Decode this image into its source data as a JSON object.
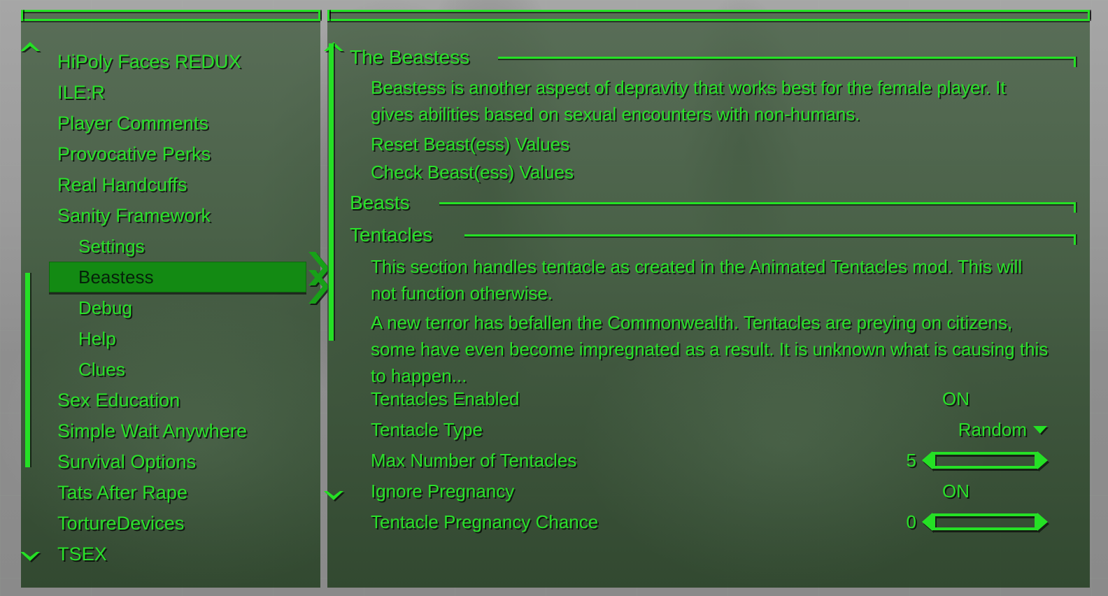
{
  "theme": {
    "accent": "#25e025",
    "text_green": "#2ae02a",
    "selected_bg": "#138a13",
    "selected_text": "#06220a"
  },
  "left_panel": {
    "scroll_up_icon": "chevron-up-icon",
    "scroll_down_icon": "chevron-down-icon",
    "items": [
      {
        "label": "HiPoly Faces REDUX",
        "level": 0,
        "selected": false
      },
      {
        "label": "ILE:R",
        "level": 0,
        "selected": false
      },
      {
        "label": "Player Comments",
        "level": 0,
        "selected": false
      },
      {
        "label": "Provocative Perks",
        "level": 0,
        "selected": false
      },
      {
        "label": "Real Handcuffs",
        "level": 0,
        "selected": false
      },
      {
        "label": "Sanity Framework",
        "level": 0,
        "selected": false
      },
      {
        "label": "Settings",
        "level": 1,
        "selected": false
      },
      {
        "label": "Beastess",
        "level": 1,
        "selected": true
      },
      {
        "label": "Debug",
        "level": 1,
        "selected": false
      },
      {
        "label": "Help",
        "level": 1,
        "selected": false
      },
      {
        "label": "Clues",
        "level": 1,
        "selected": false
      },
      {
        "label": "Sex Education",
        "level": 0,
        "selected": false
      },
      {
        "label": "Simple Wait Anywhere",
        "level": 0,
        "selected": false
      },
      {
        "label": "Survival Options",
        "level": 0,
        "selected": false
      },
      {
        "label": "Tats After Rape",
        "level": 0,
        "selected": false
      },
      {
        "label": "TortureDevices",
        "level": 0,
        "selected": false
      },
      {
        "label": "TSEX",
        "level": 0,
        "selected": false
      }
    ]
  },
  "right_panel": {
    "scroll_up_icon": "chevron-up-icon",
    "scroll_down_icon": "chevron-down-icon",
    "sections": {
      "beastess_header": "The Beastess",
      "beastess_description": "Beastess is another aspect of depravity that works best for the female player.  It gives abilities based on sexual encounters with non-humans.",
      "reset_action": "Reset Beast(ess) Values",
      "check_action": "Check Beast(ess) Values",
      "beasts_header": "Beasts",
      "tentacles_header": "Tentacles",
      "tentacles_description_1": "This section handles tentacle as created in the Animated Tentacles mod.  This will not function otherwise.",
      "tentacles_description_2": "A new terror has befallen the Commonwealth.  Tentacles are preying on citizens, some have even become impregnated as a result.  It is unknown what is causing this to happen..."
    },
    "options": [
      {
        "label": "Tentacles Enabled",
        "type": "toggle",
        "value": "ON"
      },
      {
        "label": "Tentacle Type",
        "type": "dropdown",
        "value": "Random",
        "icon": "caret-down-icon"
      },
      {
        "label": "Max Number of Tentacles",
        "type": "slider",
        "value": "5"
      },
      {
        "label": "Ignore Pregnancy",
        "type": "toggle",
        "value": "ON"
      },
      {
        "label": "Tentacle Pregnancy Chance",
        "type": "slider",
        "value": "0"
      }
    ]
  }
}
